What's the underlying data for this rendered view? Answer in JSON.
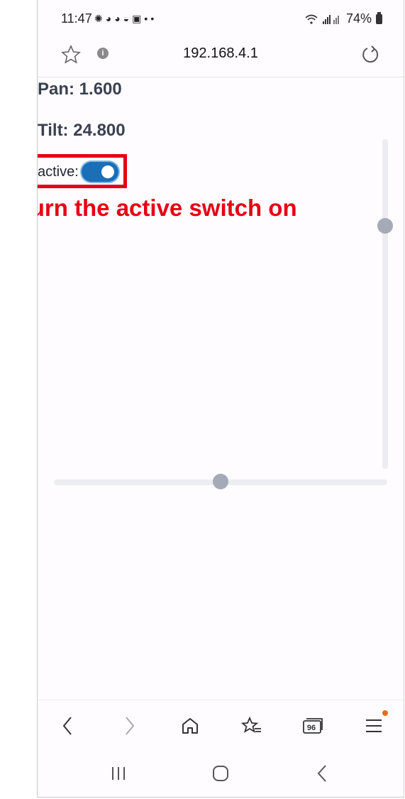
{
  "status": {
    "time": "11:47",
    "notification_icons": [
      "signal-app-icon",
      "discord-icon",
      "discord-icon",
      "generic-app-icon",
      "voicemail-icon",
      "linkedin-icon",
      "dot-icon"
    ],
    "battery": "74%"
  },
  "browser": {
    "url": "192.168.4.1"
  },
  "page": {
    "pan": "Pan: 1.600",
    "tilt": "Tilt: 24.800",
    "active_label": "active:",
    "active_on": true,
    "vertical_slider_value": 0.26,
    "horizontal_slider_value": 0.5
  },
  "annotation": {
    "text": "Turn the active switch on",
    "color": "#e60012"
  },
  "bottom_nav": {
    "tab_count": "96",
    "items": [
      "back-icon",
      "forward-icon",
      "home-icon",
      "bookmarks-icon",
      "tabs-icon",
      "menu-icon"
    ]
  },
  "colors": {
    "toggle_on": "#1a6fb6",
    "slider_thumb": "#a4aab6",
    "menu_badge": "#f06a1a"
  }
}
